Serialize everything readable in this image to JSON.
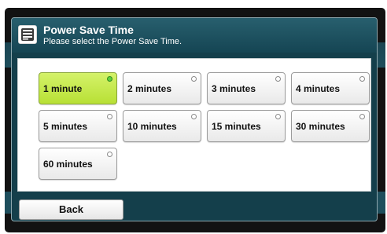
{
  "header": {
    "icon": "settings-panel-icon",
    "title": "Power Save Time",
    "subtitle": "Please select the Power Save Time."
  },
  "options": [
    {
      "label": "1 minute",
      "selected": true
    },
    {
      "label": "2 minutes",
      "selected": false
    },
    {
      "label": "3 minutes",
      "selected": false
    },
    {
      "label": "4 minutes",
      "selected": false
    },
    {
      "label": "5 minutes",
      "selected": false
    },
    {
      "label": "10 minutes",
      "selected": false
    },
    {
      "label": "15 minutes",
      "selected": false
    },
    {
      "label": "30 minutes",
      "selected": false
    },
    {
      "label": "60 minutes",
      "selected": false
    }
  ],
  "footer": {
    "back_label": "Back"
  },
  "colors": {
    "selected_fill": "#c8ea4a",
    "selected_indicator": "#5fd23d",
    "header_bg": "#1e4e5c"
  }
}
